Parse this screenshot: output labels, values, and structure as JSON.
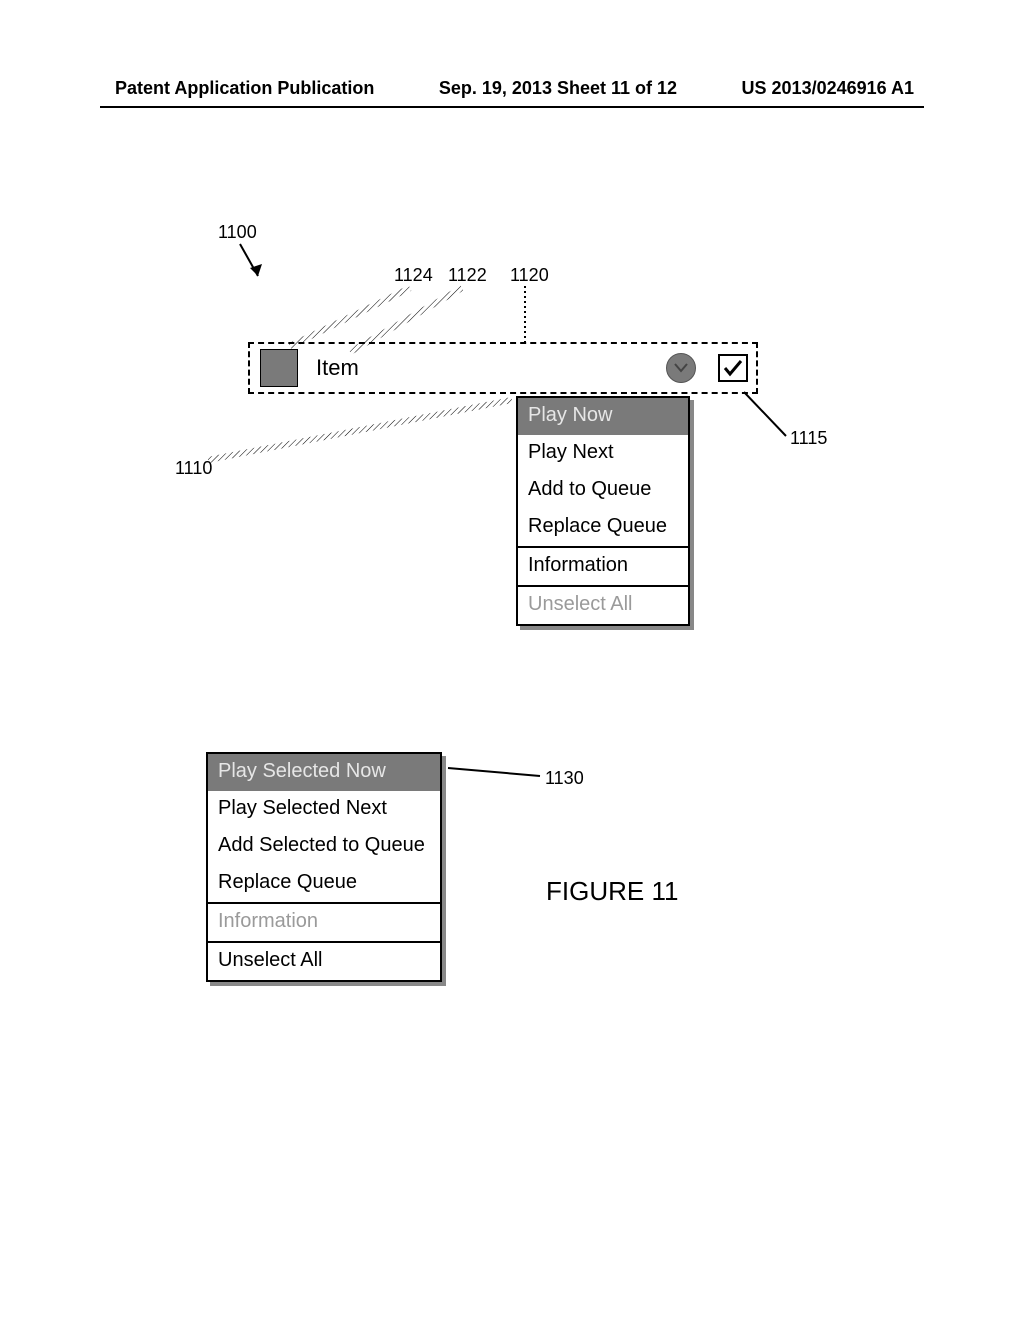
{
  "header": {
    "left": "Patent Application Publication",
    "mid": "Sep. 19, 2013  Sheet 11 of 12",
    "right": "US 2013/0246916 A1"
  },
  "figure_label": "FIGURE 11",
  "refs": {
    "r1100": "1100",
    "r1124": "1124",
    "r1122": "1122",
    "r1120": "1120",
    "r1115": "1115",
    "r1110": "1110",
    "r1130": "1130"
  },
  "item": {
    "label": "Item"
  },
  "menu_a": {
    "selected": "Play Now",
    "items_group1": [
      "Play Next",
      "Add to Queue",
      "Replace Queue"
    ],
    "item_info": "Information",
    "item_unselect": "Unselect All"
  },
  "menu_b": {
    "selected": "Play Selected Now",
    "items_group1": [
      "Play Selected Next",
      "Add Selected to Queue",
      "Replace Queue"
    ],
    "item_info": "Information",
    "item_unselect": "Unselect All"
  }
}
